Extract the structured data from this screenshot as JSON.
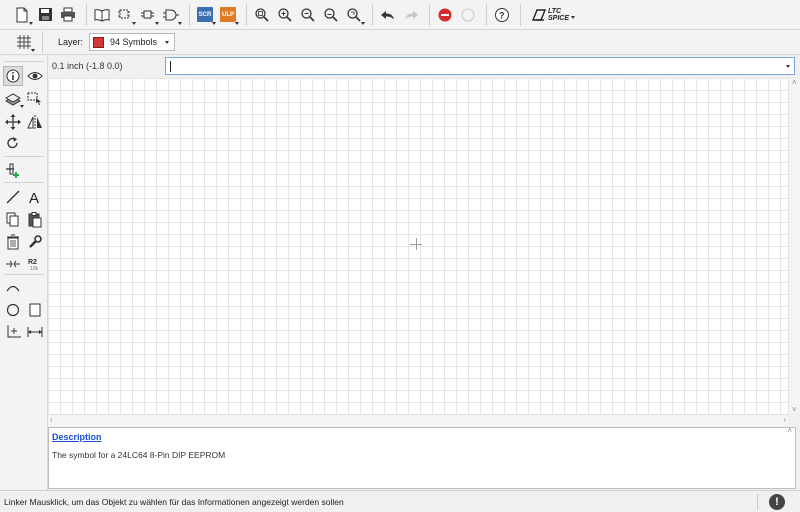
{
  "toolbar": {
    "items": [
      {
        "name": "new-icon"
      },
      {
        "name": "save-icon"
      },
      {
        "name": "print-icon"
      },
      {
        "name": "library-icon"
      },
      {
        "name": "board-icon"
      },
      {
        "name": "schematic-icon"
      },
      {
        "name": "package-icon"
      },
      {
        "name": "scr-icon"
      },
      {
        "name": "ulp-icon"
      },
      {
        "name": "zoom-fit-icon"
      },
      {
        "name": "zoom-in-icon"
      },
      {
        "name": "zoom-out-icon"
      },
      {
        "name": "zoom-select-icon"
      },
      {
        "name": "zoom-last-icon"
      },
      {
        "name": "undo-icon"
      },
      {
        "name": "redo-icon"
      },
      {
        "name": "stop-icon"
      },
      {
        "name": "go-icon"
      },
      {
        "name": "help-icon"
      }
    ],
    "scr_label": "SCR",
    "ulp_label": "ULP",
    "ltc_logo_top": "LTC",
    "ltc_logo_bottom": "SPICE"
  },
  "layerbar": {
    "label": "Layer:",
    "selected_layer": "94 Symbols",
    "layer_color": "#d23a3a"
  },
  "commandline": {
    "coordinate": "0.1 inch (-1.8 0.0)",
    "value": ""
  },
  "description": {
    "heading": "Description",
    "text": "The symbol for a 24LC64 8-Pin DIP EEPROM"
  },
  "statusbar": {
    "message": "Linker Mausklick, um das Objekt zu wählen für das Informationen angezeigt werden sollen",
    "icon_label": "!"
  },
  "lefttools": {
    "r2_label": "R2",
    "r2_sub": "10k"
  }
}
